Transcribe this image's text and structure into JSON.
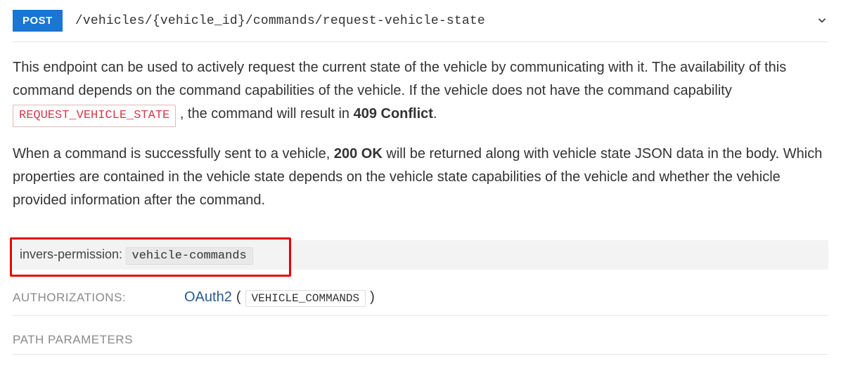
{
  "endpoint": {
    "method": "POST",
    "path": "/vehicles/{vehicle_id}/commands/request-vehicle-state"
  },
  "description": {
    "p1_a": "This endpoint can be used to actively request the current state of the vehicle by communicating with it. The availability of this command depends on the command capabilities of the vehicle. If the vehicle does not have the command capability ",
    "capability_chip": "REQUEST_VEHICLE_STATE",
    "p1_b": ", the command will result in ",
    "conflict_bold": "409 Conflict",
    "p1_c": ".",
    "p2_a": "When a command is successfully sent to a vehicle, ",
    "ok_bold": "200 OK",
    "p2_b": " will be returned along with vehicle state JSON data in the body. Which properties are contained in the vehicle state depends on the vehicle state capabilities of the vehicle and whether the vehicle provided information after the command."
  },
  "permission": {
    "label": "invers-permission:",
    "value": "vehicle-commands"
  },
  "authorizations": {
    "title": "AUTHORIZATIONS:",
    "scheme": "OAuth2",
    "scope": "VEHICLE_COMMANDS"
  },
  "path_parameters": {
    "title": "PATH PARAMETERS"
  }
}
